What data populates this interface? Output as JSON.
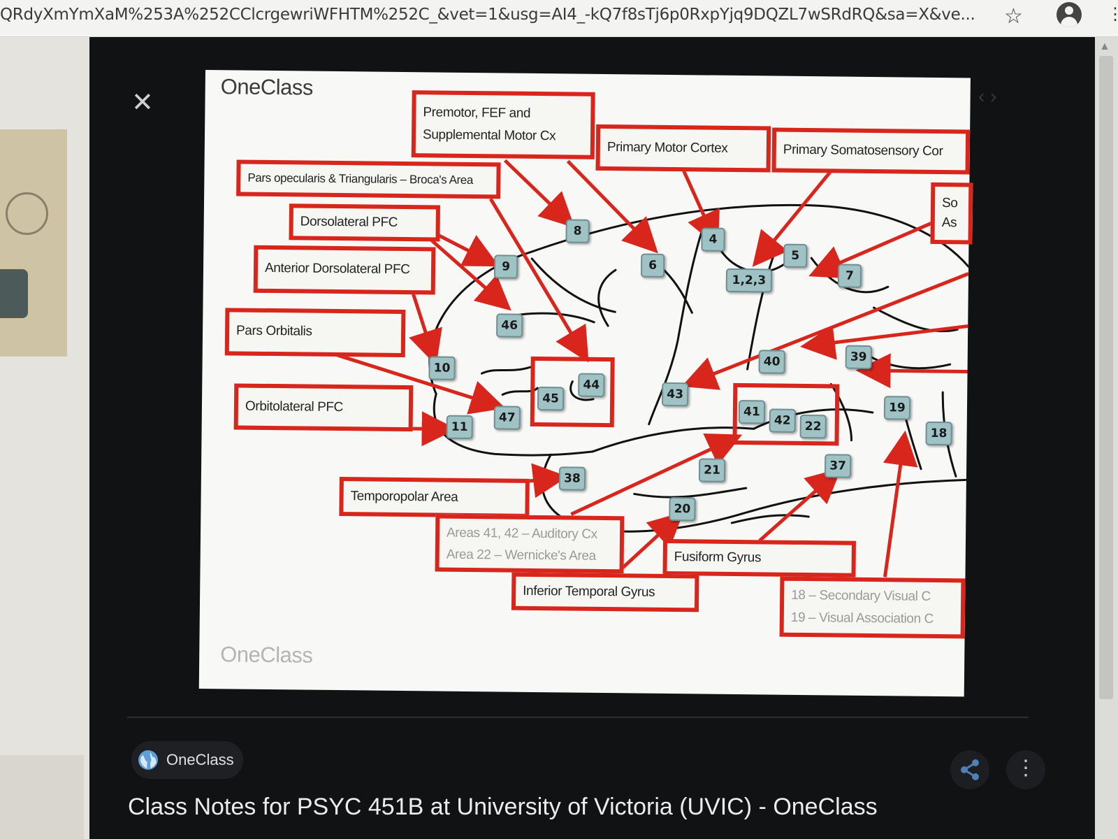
{
  "browser": {
    "url": "QRdyXmYmXaM%253A%252CClcrgewriWFHTM%252C_&vet=1&usg=AI4_-kQ7f8sTj6p0RxpYjq9DQZL7wSRdRQ&sa=X&ve...",
    "star_icon": "☆",
    "menu_icon": "⋮"
  },
  "viewer": {
    "close_icon": "✕",
    "nav_arrows": "‹  ›",
    "source_name": "OneClass",
    "more_icon": "⋮",
    "caption": "Class Notes for PSYC 451B at University of Victoria (UVIC) - OneClass"
  },
  "diagram": {
    "brand_top": "OneClass",
    "brand_watermark": "OneClass",
    "labels": {
      "premotor_1": "Premotor, FEF and",
      "premotor_2": "Supplemental Motor Cx",
      "primary_motor": "Primary Motor Cortex",
      "primary_somato": "Primary Somatosensory Cor",
      "broca": "Pars opecularis & Triangularis – Broca's Area",
      "dlpfc": "Dorsolateral PFC",
      "adlpfc": "Anterior Dorsolateral PFC",
      "pars_orbitalis": "Pars Orbitalis",
      "orbitolateral": "Orbitolateral PFC",
      "somato_assoc_1": "So",
      "somato_assoc_2": "As",
      "temporopolar": "Temporopolar Area",
      "auditory_1": "Areas 41, 42 – Auditory Cx",
      "auditory_2": "Area 22 – Wernicke's Area",
      "inferior_temporal": "Inferior Temporal Gyrus",
      "fusiform": "Fusiform Gyrus",
      "visual_1": "18 – Secondary Visual C",
      "visual_2": "19 – Visual Association C"
    },
    "areas": {
      "a8": "8",
      "a6": "6",
      "a4": "4",
      "a5": "5",
      "a7": "7",
      "a123": "1,2,3",
      "a9": "9",
      "a46": "46",
      "a10": "10",
      "a11": "11",
      "a47": "47",
      "a45": "45",
      "a44": "44",
      "a43": "43",
      "a40": "40",
      "a39": "39",
      "a41": "41",
      "a42": "42",
      "a22": "22",
      "a19": "19",
      "a18": "18",
      "a21": "21",
      "a37": "37",
      "a38": "38",
      "a20": "20"
    }
  }
}
